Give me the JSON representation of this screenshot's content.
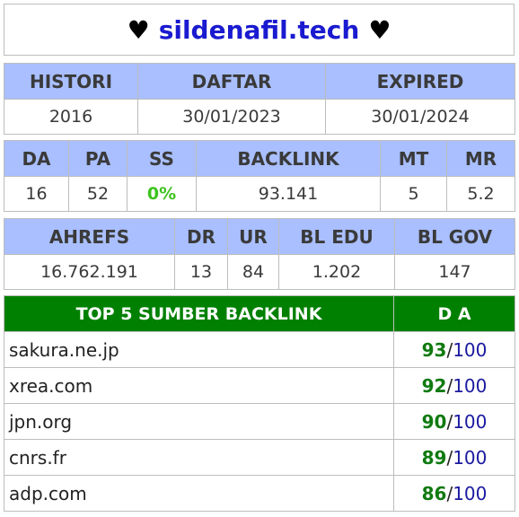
{
  "header": {
    "heart_left": "♥",
    "domain": "sildenafil.tech",
    "heart_right": "♥"
  },
  "registration": {
    "headers": [
      "HISTORI",
      "DAFTAR",
      "EXPIRED"
    ],
    "values": [
      "2016",
      "30/01/2023",
      "30/01/2024"
    ]
  },
  "moz_metrics": {
    "headers": [
      "DA",
      "PA",
      "SS",
      "BACKLINK",
      "MT",
      "MR"
    ],
    "values": [
      "16",
      "52",
      "0%",
      "93.141",
      "5",
      "5.2"
    ]
  },
  "ahrefs_metrics": {
    "headers": [
      "AHREFS",
      "DR",
      "UR",
      "BL EDU",
      "BL GOV"
    ],
    "values": [
      "16.762.191",
      "13",
      "84",
      "1.202",
      "147"
    ]
  },
  "top_backlinks": {
    "header_source": "TOP 5 SUMBER BACKLINK",
    "header_da": "D A",
    "max_label": "100",
    "separator": "/",
    "rows": [
      {
        "site": "sakura.ne.jp",
        "da": "93"
      },
      {
        "site": "xrea.com",
        "da": "92"
      },
      {
        "site": "jpn.org",
        "da": "90"
      },
      {
        "site": "cnrs.fr",
        "da": "89"
      },
      {
        "site": "adp.com",
        "da": "86"
      }
    ]
  },
  "colors": {
    "header_blue": "#a9bfff",
    "header_green": "#008000",
    "domain_blue": "#1a1ad0",
    "ss_green": "#3dc31e",
    "da_green": "#107a10"
  }
}
